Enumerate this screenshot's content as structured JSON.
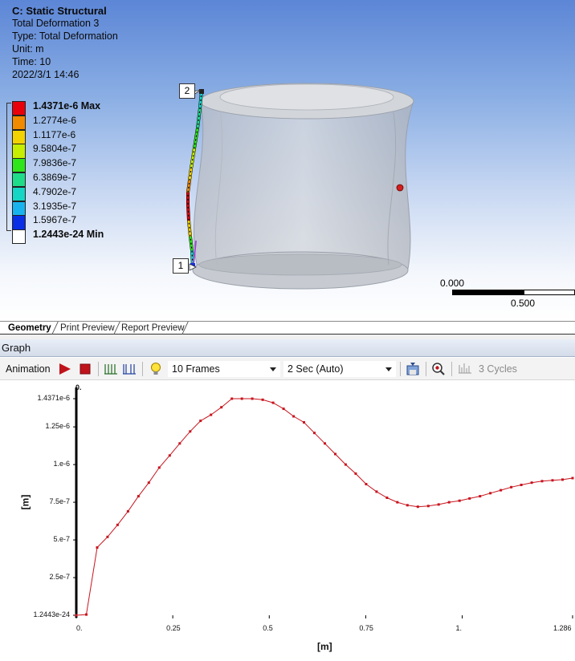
{
  "info": {
    "title": "C: Static Structural",
    "result_name": "Total Deformation 3",
    "type": "Type: Total Deformation",
    "unit": "Unit: m",
    "time": "Time: 10",
    "timestamp": "2022/3/1 14:46"
  },
  "legend": {
    "entries": [
      {
        "label": "1.4371e-6 Max",
        "color": "#e8000b",
        "bold": true
      },
      {
        "label": "1.2774e-6",
        "color": "#f08a00"
      },
      {
        "label": "1.1177e-6",
        "color": "#f2d200"
      },
      {
        "label": "9.5804e-7",
        "color": "#c6ee00"
      },
      {
        "label": "7.9836e-7",
        "color": "#2ee61a"
      },
      {
        "label": "6.3869e-7",
        "color": "#1fdc8a"
      },
      {
        "label": "4.7902e-7",
        "color": "#15d6c4"
      },
      {
        "label": "3.1935e-7",
        "color": "#18b3ee"
      },
      {
        "label": "1.5967e-7",
        "color": "#0a2ee6"
      },
      {
        "label": "1.2443e-24 Min",
        "color": "#ffffff",
        "bold": true
      }
    ]
  },
  "probes": {
    "start": "1",
    "end": "2"
  },
  "scale": {
    "start": "0.000",
    "end": "0.500"
  },
  "tabs": [
    {
      "label": "Geometry",
      "active": true
    },
    {
      "label": "Print Preview",
      "active": false
    },
    {
      "label": "Report Preview",
      "active": false
    }
  ],
  "graph": {
    "header": "Graph",
    "animation_label": "Animation",
    "frames_value": "10 Frames",
    "duration_value": "2 Sec (Auto)",
    "cycles_label": "3 Cycles",
    "top_label": "0."
  },
  "icons": {
    "play": "play-icon",
    "stop": "stop-icon",
    "distributed_frames": "distributed-frames-icon",
    "result_frames": "result-frames-icon",
    "bulb": "lightbulb-icon",
    "export": "export-video-icon",
    "zoom": "zoom-fit-icon",
    "cycles": "cycles-icon"
  },
  "chart_data": {
    "type": "line",
    "xlabel": "[m]",
    "ylabel": "[m]",
    "xlim": [
      0,
      1.286
    ],
    "ylim": [
      1.2443e-24,
      1.4371e-06
    ],
    "x_ticks": [
      {
        "v": 0,
        "label": "0."
      },
      {
        "v": 0.25,
        "label": "0.25"
      },
      {
        "v": 0.5,
        "label": "0.5"
      },
      {
        "v": 0.75,
        "label": "0.75"
      },
      {
        "v": 1.0,
        "label": "1."
      },
      {
        "v": 1.286,
        "label": "1.286"
      }
    ],
    "y_ticks": [
      {
        "v": 1.2443e-24,
        "label": "1.2443e-24"
      },
      {
        "v": 2.5e-07,
        "label": "2.5e-7"
      },
      {
        "v": 5e-07,
        "label": "5.e-7"
      },
      {
        "v": 7.5e-07,
        "label": "7.5e-7"
      },
      {
        "v": 1e-06,
        "label": "1.e-6"
      },
      {
        "v": 1.25e-06,
        "label": "1.25e-6"
      },
      {
        "v": 1.4371e-06,
        "label": "1.4371e-6"
      }
    ],
    "series": [
      {
        "color": "#c8141e",
        "x": [
          0,
          0.026,
          0.054,
          0.081,
          0.107,
          0.134,
          0.161,
          0.188,
          0.215,
          0.242,
          0.268,
          0.295,
          0.322,
          0.349,
          0.376,
          0.403,
          0.429,
          0.456,
          0.483,
          0.51,
          0.537,
          0.563,
          0.59,
          0.617,
          0.644,
          0.671,
          0.698,
          0.724,
          0.751,
          0.778,
          0.805,
          0.832,
          0.858,
          0.885,
          0.912,
          0.939,
          0.966,
          0.993,
          1.019,
          1.046,
          1.073,
          1.1,
          1.127,
          1.153,
          1.18,
          1.207,
          1.234,
          1.26,
          1.286
        ],
        "y": [
          1e-24,
          5e-09,
          4.5e-07,
          5.2e-07,
          6e-07,
          6.9e-07,
          7.9e-07,
          8.8e-07,
          9.8e-07,
          1.06e-06,
          1.14e-06,
          1.22e-06,
          1.29e-06,
          1.33e-06,
          1.38e-06,
          1.4371e-06,
          1.4371e-06,
          1.4371e-06,
          1.43e-06,
          1.41e-06,
          1.37e-06,
          1.32e-06,
          1.28e-06,
          1.21e-06,
          1.14e-06,
          1.07e-06,
          1e-06,
          9.4e-07,
          8.7e-07,
          8.2e-07,
          7.8e-07,
          7.5e-07,
          7.3e-07,
          7.2e-07,
          7.25e-07,
          7.35e-07,
          7.5e-07,
          7.6e-07,
          7.75e-07,
          7.9e-07,
          8.1e-07,
          8.3e-07,
          8.5e-07,
          8.65e-07,
          8.8e-07,
          8.9e-07,
          8.95e-07,
          9e-07,
          9.1e-07
        ]
      }
    ]
  }
}
